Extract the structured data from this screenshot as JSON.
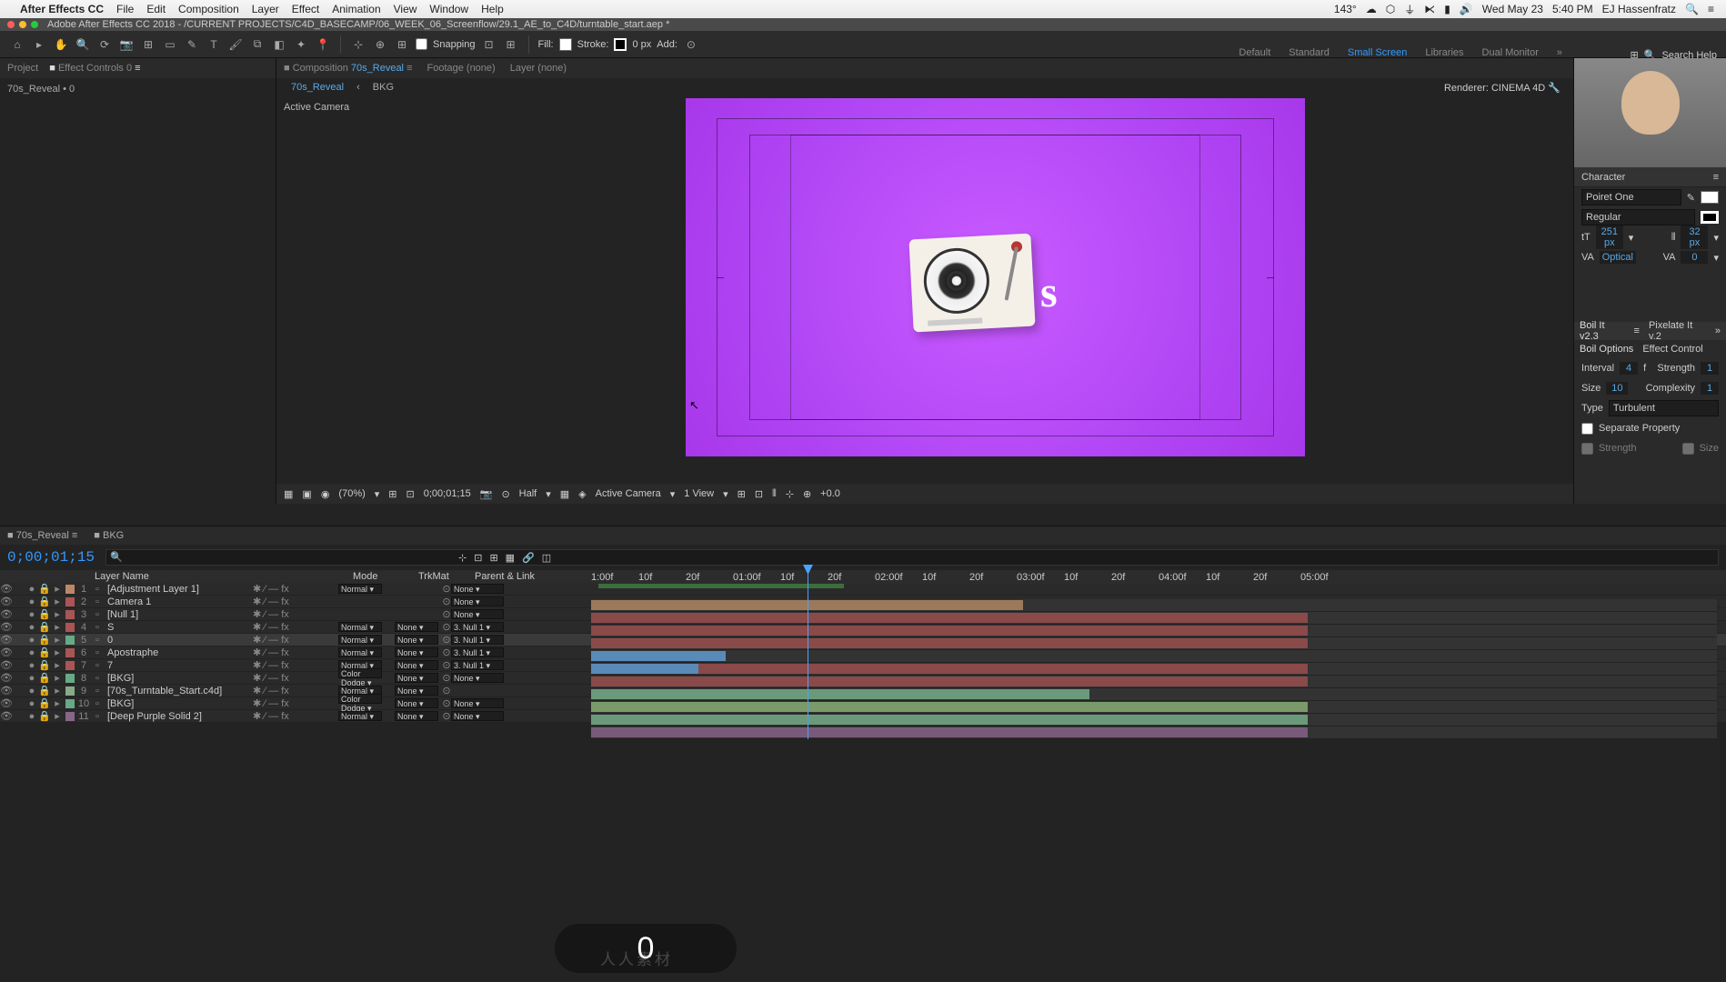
{
  "menubar": {
    "app": "After Effects CC",
    "items": [
      "File",
      "Edit",
      "Composition",
      "Layer",
      "Effect",
      "Animation",
      "View",
      "Window",
      "Help"
    ],
    "temp": "143°",
    "date": "Wed May 23",
    "time": "5:40 PM",
    "user": "EJ Hassenfratz"
  },
  "titlebar": "Adobe After Effects CC 2018 - /CURRENT PROJECTS/C4D_BASECAMP/06_WEEK_06_Screenflow/29.1_AE_to_C4D/turntable_start.aep *",
  "toolbar": {
    "snapping": "Snapping",
    "fill": "Fill:",
    "stroke": "Stroke:",
    "strokepx": "0 px",
    "add": "Add:"
  },
  "workspaces": [
    "Default",
    "Standard",
    "Small Screen",
    "Libraries",
    "Dual Monitor"
  ],
  "search": "Search Help",
  "project": {
    "tab1": "Project",
    "tab2": "Effect Controls 0",
    "sub": "70s_Reveal • 0"
  },
  "comp": {
    "t1": "Composition",
    "t1n": "70s_Reveal",
    "t2": "Footage (none)",
    "t3": "Layer (none)",
    "sub1": "70s_Reveal",
    "sub2": "BKG",
    "renderer": "Renderer:",
    "rname": "CINEMA 4D",
    "ac": "Active Camera"
  },
  "viewbar": {
    "zoom": "(70%)",
    "tc": "0;00;01;15",
    "res": "Half",
    "cam": "Active Camera",
    "view": "1 View",
    "exp": "+0.0"
  },
  "char": {
    "title": "Character",
    "font": "Poiret One",
    "style": "Regular",
    "size": "251 px",
    "leading": "32 px",
    "kerning": "Optical",
    "tracking": "0"
  },
  "boil": {
    "t1": "Boil It v2.3",
    "t2": "Pixelate It v.2",
    "opt": "Boil Options",
    "ec": "Effect Control",
    "interval": "Interval",
    "intv": "4",
    "intu": "f",
    "strength": "Strength",
    "strv": "1",
    "size": "Size",
    "sizev": "10",
    "cplx": "Complexity",
    "cplxv": "1",
    "type": "Type",
    "typev": "Turbulent",
    "sep": "Separate Property",
    "str2": "Strength",
    "siz2": "Size"
  },
  "tl": {
    "tab1": "70s_Reveal",
    "tab2": "BKG",
    "tc": "0;00;01;15",
    "cols": {
      "ln": "Layer Name",
      "mode": "Mode",
      "trk": "TrkMat",
      "par": "Parent & Link"
    }
  },
  "layers": [
    {
      "n": "1",
      "label": "#b86",
      "name": "[Adjustment Layer 1]",
      "mode": "Normal",
      "trk": "",
      "par": "None",
      "sel": false
    },
    {
      "n": "2",
      "label": "#a55",
      "name": "Camera 1",
      "mode": "",
      "trk": "",
      "par": "None",
      "sel": false
    },
    {
      "n": "3",
      "label": "#a55",
      "name": "[Null 1]",
      "mode": "",
      "trk": "",
      "par": "None",
      "sel": false
    },
    {
      "n": "4",
      "label": "#a55",
      "name": "S",
      "mode": "Normal",
      "trk": "None",
      "par": "3. Null 1",
      "sel": false
    },
    {
      "n": "5",
      "label": "#6a8",
      "name": "0",
      "mode": "Normal",
      "trk": "None",
      "par": "3. Null 1",
      "sel": true
    },
    {
      "n": "6",
      "label": "#a55",
      "name": "Apostraphe",
      "mode": "Normal",
      "trk": "None",
      "par": "3. Null 1",
      "sel": false
    },
    {
      "n": "7",
      "label": "#a55",
      "name": "7",
      "mode": "Normal",
      "trk": "None",
      "par": "3. Null 1",
      "sel": false
    },
    {
      "n": "8",
      "label": "#6a8",
      "name": "[BKG]",
      "mode": "Color Dodge",
      "trk": "None",
      "par": "None",
      "sel": false
    },
    {
      "n": "9",
      "label": "#8a8",
      "name": "[70s_Turntable_Start.c4d]",
      "mode": "Normal",
      "trk": "None",
      "par": "",
      "sel": false
    },
    {
      "n": "10",
      "label": "#6a8",
      "name": "[BKG]",
      "mode": "Color Dodge",
      "trk": "None",
      "par": "None",
      "sel": false
    },
    {
      "n": "11",
      "label": "#868",
      "name": "[Deep Purple Solid 2]",
      "mode": "Normal",
      "trk": "None",
      "par": "None",
      "sel": false
    }
  ],
  "ruler": [
    "1:00f",
    "10f",
    "20f",
    "01:00f",
    "10f",
    "20f",
    "02:00f",
    "10f",
    "20f",
    "03:00f",
    "10f",
    "20f",
    "04:00f",
    "10f",
    "20f",
    "05:00f"
  ],
  "key": "0",
  "watermark": "人人素材"
}
